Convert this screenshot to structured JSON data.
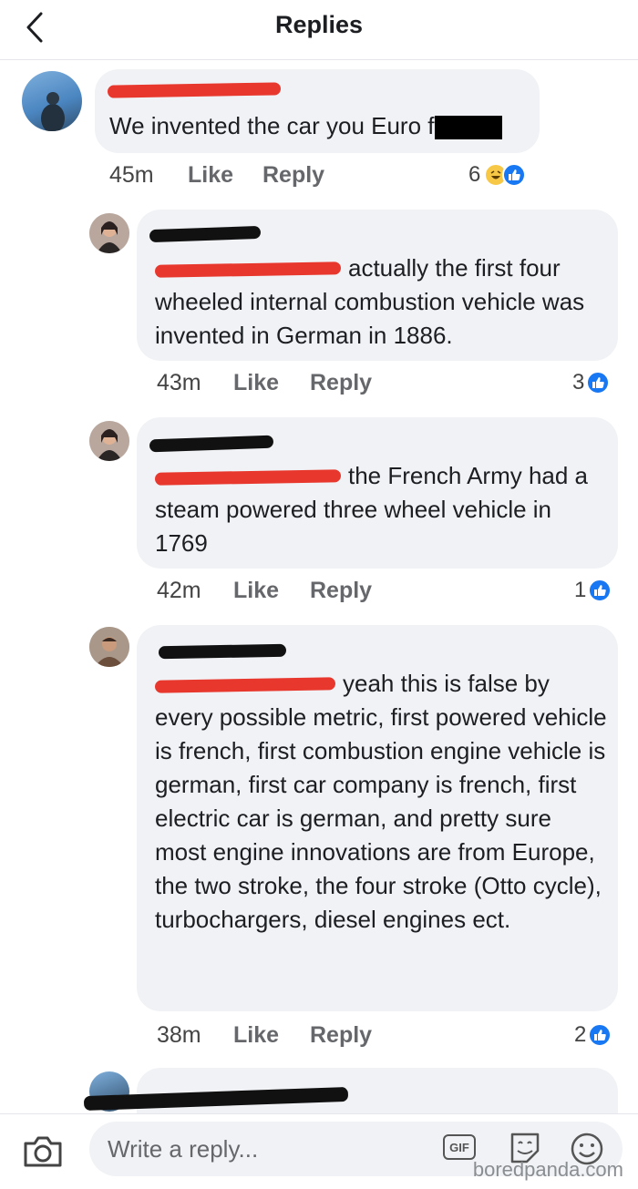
{
  "header": {
    "title": "Replies",
    "back_icon": "chevron-left-icon"
  },
  "comments": [
    {
      "text": "We invented the car you Euro f",
      "time": "45m",
      "like": "Like",
      "reply": "Reply",
      "reaction_count": "6",
      "reactions": [
        "haha-icon",
        "like-icon"
      ]
    },
    {
      "text": "actually the first four wheeled internal combustion vehicle was invented in German in 1886.",
      "time": "43m",
      "like": "Like",
      "reply": "Reply",
      "reaction_count": "3",
      "reactions": [
        "like-icon"
      ]
    },
    {
      "text": "the French Army had a steam powered three wheel vehicle in 1769",
      "time": "42m",
      "like": "Like",
      "reply": "Reply",
      "reaction_count": "1",
      "reactions": [
        "like-icon"
      ]
    },
    {
      "text": "yeah this is false by every possible metric, first powered vehicle is french, first combustion engine vehicle is german, first car company is french, first electric car is german, and pretty sure most engine innovations are from Europe, the two stroke, the four stroke (Otto cycle), turbochargers, diesel engines ect.",
      "time": "38m",
      "like": "Like",
      "reply": "Reply",
      "reaction_count": "2",
      "reactions": [
        "like-icon"
      ]
    }
  ],
  "composer": {
    "placeholder": "Write a reply...",
    "gif_label": "GIF"
  },
  "watermark": "boredpanda.com",
  "colors": {
    "like_blue": "#1877f2",
    "bubble_bg": "#f0f2f5",
    "redact_red": "#e8372c"
  }
}
